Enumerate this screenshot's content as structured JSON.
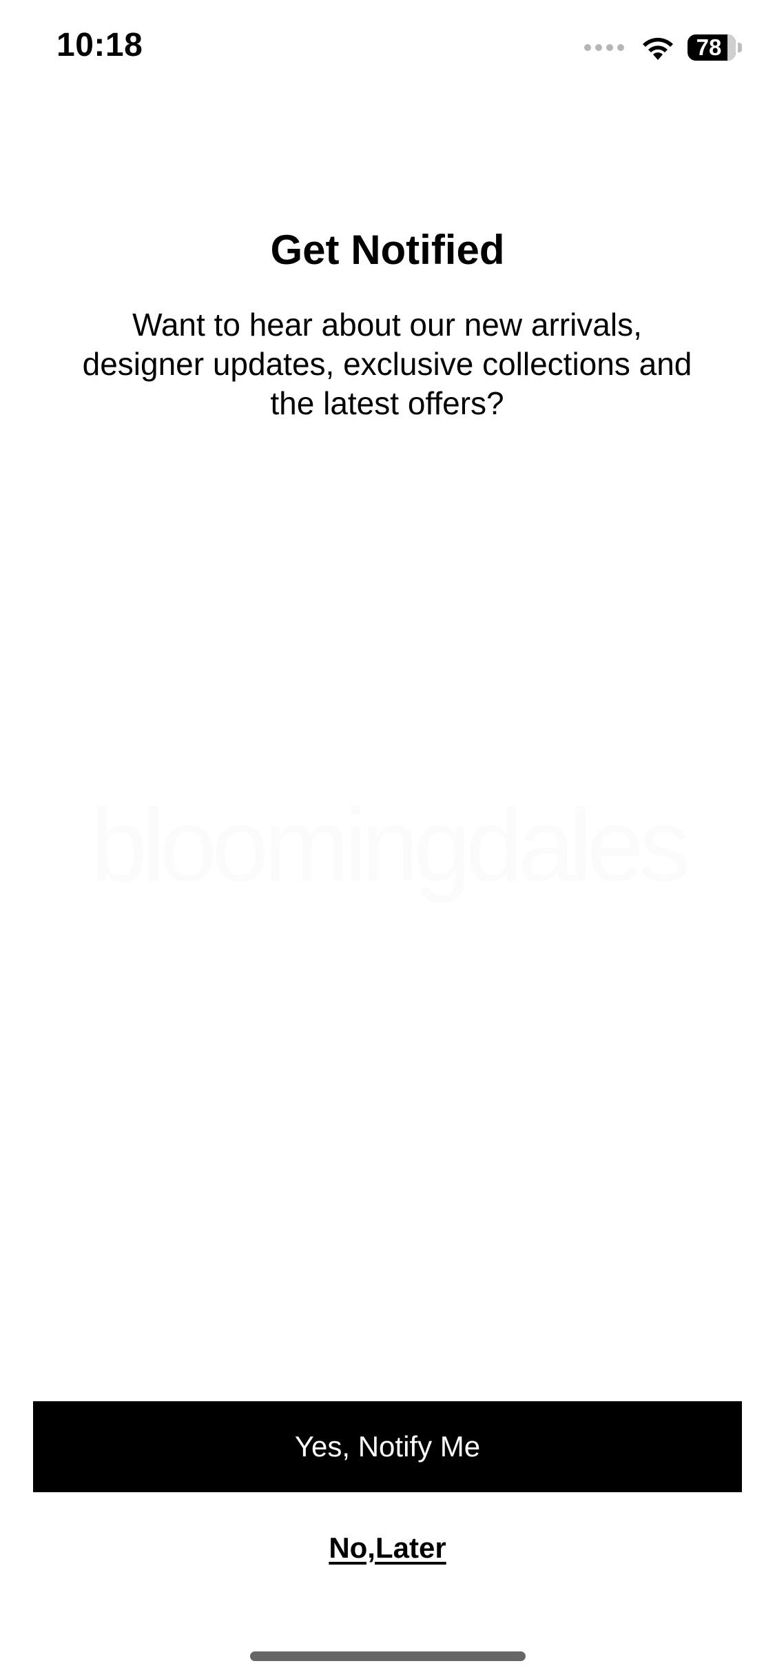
{
  "status_bar": {
    "time": "10:18",
    "battery_level": "78",
    "icons": [
      "signal-icon",
      "wifi-icon",
      "battery-icon"
    ]
  },
  "dialog": {
    "title": "Get Notified",
    "description": "Want to hear about our new arrivals, designer updates, exclusive collections and the latest offers?",
    "watermark_logo": "bloomingdales"
  },
  "actions": {
    "primary_label": "Yes, Notify Me",
    "secondary_label": "No,Later"
  },
  "colors": {
    "background": "#ffffff",
    "primary_button": "#000000",
    "primary_button_text": "#ffffff",
    "text": "#000000"
  }
}
